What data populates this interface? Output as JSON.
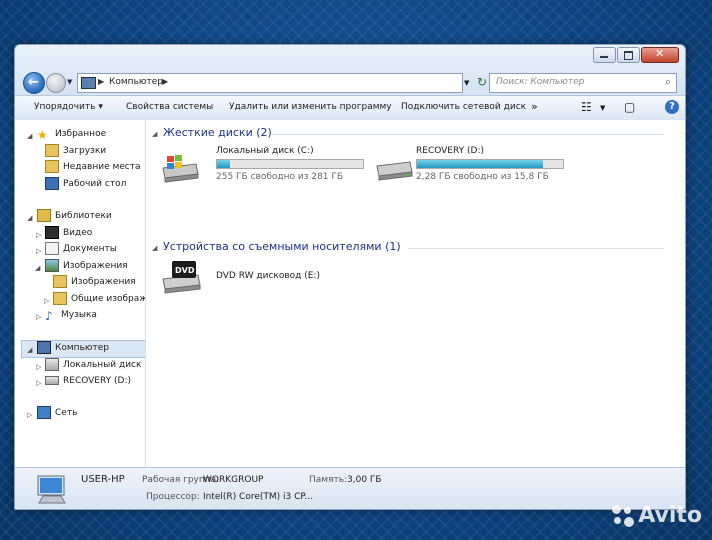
{
  "window": {
    "caption_buttons": [
      "minimize",
      "maximize",
      "close"
    ]
  },
  "address": {
    "path": "Компьютер",
    "search_placeholder": "Поиск: Компьютер"
  },
  "toolbar": {
    "organize": "Упорядочить",
    "system_properties": "Свойства системы",
    "uninstall": "Удалить или изменить программу",
    "map_drive": "Подключить сетевой диск",
    "more": "»"
  },
  "nav": {
    "favorites": "Избранное",
    "downloads": "Загрузки",
    "recent": "Недавние места",
    "desktop": "Рабочий стол",
    "libraries": "Библиотеки",
    "video": "Видео",
    "documents": "Документы",
    "images": "Изображения",
    "my_images": "Изображения",
    "public_images": "Общие изображе",
    "music": "Музыка",
    "computer": "Компьютер",
    "local_disk": "Локальный диск (C",
    "recovery": "RECOVERY (D:)",
    "network": "Сеть"
  },
  "content": {
    "hdd_group": "Жесткие диски (2)",
    "removable_group": "Устройства со съемными носителями (1)",
    "drives": [
      {
        "name": "Локальный диск (C:)",
        "free": "255 ГБ свободно из 281 ГБ",
        "used_fraction": 0.09
      },
      {
        "name": "RECOVERY (D:)",
        "free": "2,28 ГБ свободно из 15,8 ГБ",
        "used_fraction": 0.86
      }
    ],
    "dvd": {
      "name": "DVD RW дисковод (E:)",
      "badge": "DVD"
    }
  },
  "status": {
    "computer_name": "USER-HP",
    "workgroup_label": "Рабочая группа:",
    "workgroup_value": "WORKGROUP",
    "memory_label": "Память:",
    "memory_value": "3,00 ГБ",
    "cpu_label": "Процессор:",
    "cpu_value": "Intel(R) Core(TM) i3 CP..."
  },
  "watermark": "Avito",
  "colors": {
    "desktop_bg": "#0d4684",
    "drive_bar_fill": "#1f98c4",
    "group_header": "#1e3287",
    "selection": "#dbe7f5"
  }
}
